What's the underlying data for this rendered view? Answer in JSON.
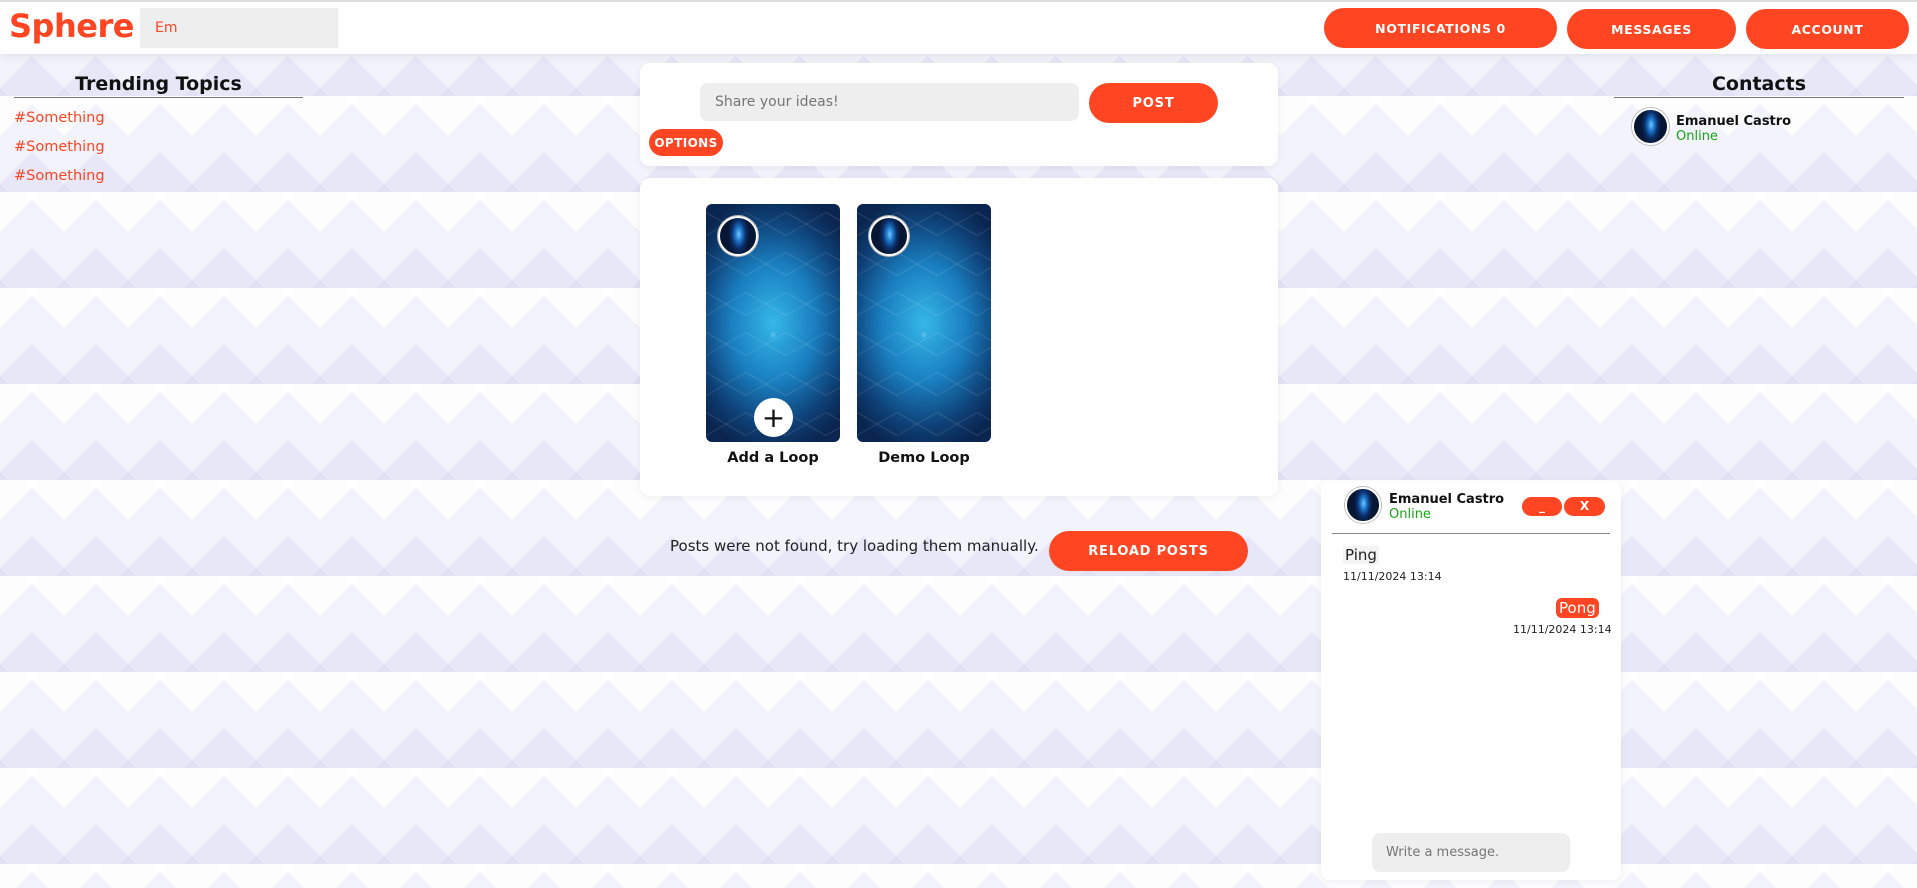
{
  "app": {
    "logo": "Sphere",
    "search_value": "Em",
    "accent_color": "#ff4521"
  },
  "header": {
    "notifications_label": "NOTIFICATIONS 0",
    "messages_label": "MESSAGES",
    "account_label": "ACCOUNT"
  },
  "trending": {
    "title": "Trending Topics",
    "topics": [
      "#Something",
      "#Something",
      "#Something"
    ]
  },
  "contacts": {
    "title": "Contacts",
    "items": [
      {
        "name": "Emanuel Castro",
        "status": "Online"
      }
    ]
  },
  "composer": {
    "placeholder": "Share your ideas!",
    "post_label": "POST",
    "options_label": "OPTIONS"
  },
  "loops": {
    "add_icon": "+",
    "items": [
      {
        "label": "Add a Loop"
      },
      {
        "label": "Demo Loop"
      }
    ]
  },
  "feed": {
    "empty_message": "Posts were not found, try loading them manually.",
    "reload_label": "RELOAD POSTS"
  },
  "chat": {
    "name": "Emanuel Castro",
    "status": "Online",
    "minimize_label": "_",
    "close_label": "X",
    "messages": [
      {
        "text": "Ping",
        "time": "11/11/2024 13:14",
        "side": "left"
      },
      {
        "text": "Pong",
        "time": "11/11/2024 13:14",
        "side": "right"
      }
    ],
    "input_placeholder": "Write a message."
  }
}
